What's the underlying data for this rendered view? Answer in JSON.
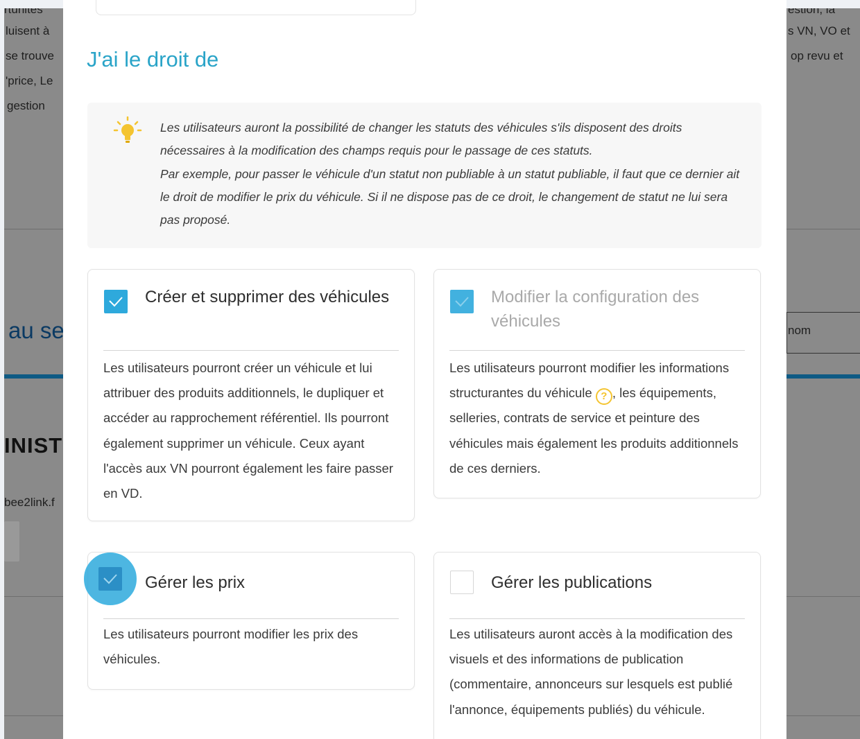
{
  "background": {
    "fragments": [
      "rtunités",
      "luisent à",
      "se trouve",
      "'price, Le",
      "gestion",
      "au se",
      "INIST",
      "bee2link.f",
      "estion, la",
      "s VN, VO et",
      "op revu et",
      "nom"
    ]
  },
  "modal": {
    "section_title": "J'ai le droit de",
    "info": {
      "icon": "lightbulb-icon",
      "paragraph_1": "Les utilisateurs auront la possibilité de changer les statuts des véhicules s'ils disposent des droits nécessaires à la modification des champs requis pour le passage de ces statuts.",
      "paragraph_2": "Par exemple, pour passer le véhicule d'un statut non publiable à un statut publiable, il faut que ce dernier ait le droit de modifier le prix du véhicule. Si il ne dispose pas de ce droit, le changement de statut ne lui sera pas proposé."
    },
    "permissions": [
      {
        "title": "Créer et supprimer des véhicules",
        "checked": true,
        "disabled": false,
        "description": "Les utilisateurs pourront créer un véhicule et lui attribuer des produits additionnels, le dupliquer et accéder au rapprochement référentiel. Ils pourront également supprimer un véhicule. Ceux ayant l'accès aux VN pourront également les faire passer en VD."
      },
      {
        "title": "Modifier la configuration des véhicules",
        "checked": true,
        "disabled": true,
        "description_before_icon": "Les utilisateurs pourront modifier les informations structurantes du véhicule",
        "help_icon": "?",
        "description_after_icon": ", les équipements, selleries, contrats de service et peinture des véhicules mais également les produits additionnels de ces derniers."
      },
      {
        "title": "Gérer les prix",
        "checked": true,
        "disabled": false,
        "description": "Les utilisateurs pourront modifier les prix des véhicules."
      },
      {
        "title": "Gérer les publications",
        "checked": false,
        "disabled": false,
        "description": "Les utilisateurs auront accès à la modification des visuels et des informations de publication (commentaire, annonceurs sur lesquels est publié l'annonce, équipements publiés) du véhicule."
      }
    ]
  },
  "colors": {
    "accent": "#2ea9dc",
    "title": "#2aa4c8",
    "overlay": "#8a8a8a",
    "help_icon": "#f4c430"
  }
}
